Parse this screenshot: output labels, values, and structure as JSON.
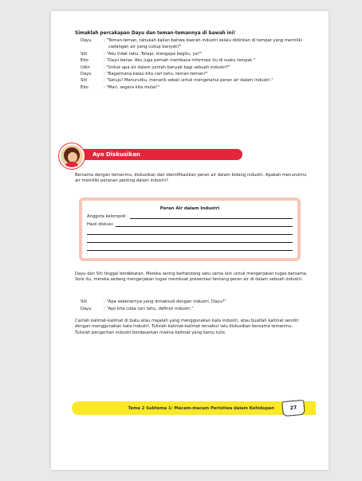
{
  "intro": "Simaklah percakapan Dayu dan teman-temannya di bawah ini!",
  "dialogue": [
    {
      "speaker": "Dayu",
      "text": ": \"Teman-teman, tahukah kalian bahwa daerah industri selalu didirikan di tempat yang memiliki cadangan air yang cukup banyak?\""
    },
    {
      "speaker": "Siti",
      "text": ": \"Aku tidak tahu. Tetapi, mengapa begitu, ya?\""
    },
    {
      "speaker": "Edo",
      "text": ": \"Dayu benar. Aku juga pernah membaca informasi itu di suatu tempat.\""
    },
    {
      "speaker": "Udin",
      "text": ": \"Untuk apa air dalam jumlah banyak bagi sebuah industri?\""
    },
    {
      "speaker": "Dayu",
      "text": ": \"Bagaimana kalau kita cari tahu, teman-teman?\""
    },
    {
      "speaker": "Siti",
      "text": ": \"Setuju! Menurutku, menarik sekali untuk mengetahui peran air dalam industri.\""
    },
    {
      "speaker": "Edo",
      "text": ": \"Mari, segera kita mulai!\""
    }
  ],
  "banner": {
    "label": "Ayo Diskusikan"
  },
  "para1": "Bersama dengan temanmu, diskusikan dan identifikasikan peran air dalam bidang industri. Apakah menurutmu air memiliki peranan penting dalam industri?",
  "box": {
    "title": "Peran Air dalam Industri",
    "field1": "Anggota kelompok :",
    "field2": "Hasil diskusi:"
  },
  "para2": "Dayu dan Siti tinggal berdekatan. Mereka sering bertandang satu sama lain untuk mengerjakan tugas bersama. Sore itu, mereka sedang mengerjakan tugas membuat presentasi tentang peran air di dalam sebuah industri.",
  "dialogue2": [
    {
      "speaker": "Siti",
      "text": ": \"Apa sebenarnya yang dimaksud dengan industri, Dayu?\""
    },
    {
      "speaker": "Dayu",
      "text": ": \"Ayo kita coba cari tahu, definisi industri.\""
    }
  ],
  "para3": "Carilah kalimat-kalimat di buku atau majalah yang menggunakan kata industri, atau buatlah kalimat sendiri dengan menggunakan kata industri. Tulislah kalimat-kalimat tersebut lalu diskusikan bersama temanmu. Tulislah pengertian industri berdasarkan makna kalimat yang kamu tulis.",
  "footer": {
    "text": "Tema 2 Subtema 1: Macam-macam Peristiwa dalam Kehidupan",
    "page": "27"
  },
  "colors": {
    "accent": "#e3263a",
    "footer": "#fbe829",
    "box_border": "#f6c7b7"
  }
}
